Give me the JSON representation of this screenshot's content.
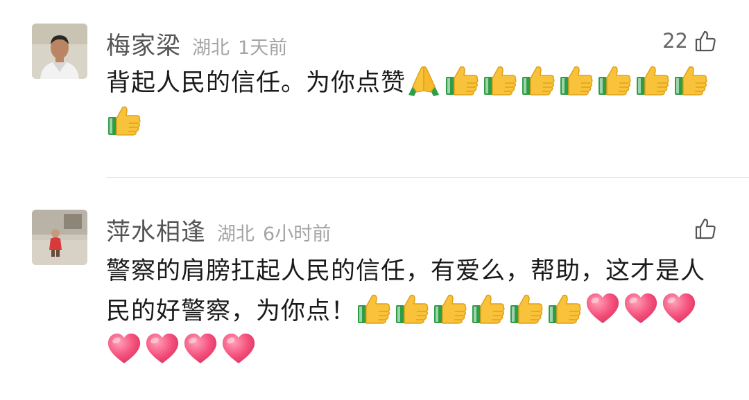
{
  "comments": [
    {
      "username": "梅家梁",
      "location": "湖北",
      "time": "1天前",
      "likes": "22",
      "text": "背起人民的信任。为你点赞",
      "emojis": [
        "folded-hands",
        "thumbs-up",
        "thumbs-up",
        "thumbs-up",
        "thumbs-up",
        "thumbs-up",
        "thumbs-up",
        "thumbs-up",
        "thumbs-up"
      ]
    },
    {
      "username": "萍水相逢",
      "location": "湖北",
      "time": "6小时前",
      "likes": "",
      "text": "警察的肩膀扛起人民的信任，有爱么，帮助，这才是人民的好警察，为你点！",
      "emojis": [
        "thumbs-up",
        "thumbs-up",
        "thumbs-up",
        "thumbs-up",
        "thumbs-up",
        "thumbs-up",
        "heart",
        "heart",
        "heart",
        "heart",
        "heart",
        "heart",
        "heart"
      ]
    }
  ],
  "colors": {
    "username": "#555555",
    "meta": "#a4a4a4",
    "text": "#1a1a1a",
    "divider": "#e8e8e8"
  },
  "icons": {
    "like": "thumbs-up-outline-icon"
  }
}
